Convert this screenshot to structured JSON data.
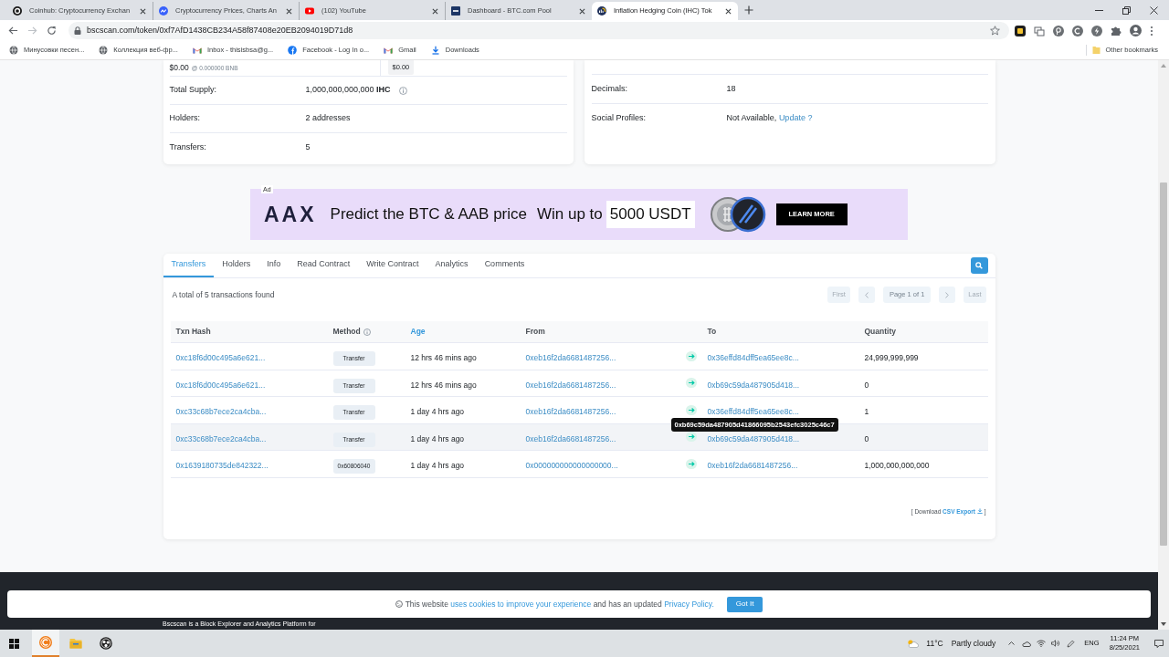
{
  "browser": {
    "tabs": [
      {
        "title": "Coinhub: Cryptocurrency Exchan",
        "kind": "ring",
        "selected": false
      },
      {
        "title": "Cryptocurrency Prices, Charts An",
        "kind": "badge",
        "selected": false
      },
      {
        "title": "(102) YouTube",
        "kind": "play",
        "selected": false
      },
      {
        "title": "Dashboard - BTC.com Pool",
        "kind": "square",
        "selected": false
      },
      {
        "title": "Inflation Hedging Coin (IHC) Tok",
        "kind": "logo",
        "selected": true
      }
    ],
    "address": "bscscan.com/token/0xf7AfD1438CB234A58f87408e20EB2094019D71d8",
    "bookmarks": [
      {
        "label": "Минусовки песен...",
        "kind": "globe"
      },
      {
        "label": "Коллекция веб-фр...",
        "kind": "globe"
      },
      {
        "label": "Inbox - thisisbsa@g...",
        "kind": "mail"
      },
      {
        "label": "Facebook - Log In o...",
        "kind": "social"
      },
      {
        "label": "Gmail",
        "kind": "mail"
      },
      {
        "label": "Downloads",
        "kind": "download"
      }
    ],
    "other_bookmarks": "Other bookmarks"
  },
  "overview": {
    "price": "$0.00",
    "price_bnb": "@ 0.000000 BNB",
    "market_cap": "$0.00",
    "rows": [
      {
        "label": "Total Supply:",
        "value": "1,000,000,000,000 **IHC**",
        "info": true
      },
      {
        "label": "Holders:",
        "value": "2 addresses",
        "info": false
      },
      {
        "label": "Transfers:",
        "value": "5",
        "info": false
      }
    ]
  },
  "profile": {
    "rows": [
      {
        "label": "Decimals:",
        "value": "18"
      },
      {
        "label": "Social Profiles:",
        "value": "Not Available,",
        "link": "Update ?"
      }
    ]
  },
  "ad": {
    "tag": "Ad",
    "logo": "AAX",
    "headline": "Predict the BTC & AAB price",
    "offer": "Win up to",
    "highlight": "5000 USDT",
    "button": "LEARN MORE"
  },
  "tabs": [
    {
      "label": "Transfers",
      "selected": true
    },
    {
      "label": "Holders",
      "selected": false
    },
    {
      "label": "Info",
      "selected": false
    },
    {
      "label": "Read Contract",
      "selected": false
    },
    {
      "label": "Write Contract",
      "selected": false
    },
    {
      "label": "Analytics",
      "selected": false
    },
    {
      "label": "Comments",
      "selected": false
    }
  ],
  "summary": "A total of 5 transactions found",
  "pagination": [
    {
      "kind": "first",
      "label": "First",
      "disabled": true
    },
    {
      "kind": "prev",
      "disabled": true
    },
    {
      "kind": "page",
      "label": "Page 1 of 1"
    },
    {
      "kind": "next",
      "disabled": true
    },
    {
      "kind": "last",
      "label": "Last",
      "disabled": true
    }
  ],
  "table": {
    "columns": [
      {
        "label": "Txn Hash",
        "kind": "text"
      },
      {
        "label": "Method",
        "kind": "info"
      },
      {
        "label": "Age",
        "kind": "link"
      },
      {
        "label": "From",
        "kind": "text"
      },
      {
        "label": "To",
        "kind": "text"
      },
      {
        "label": "Quantity",
        "kind": "text"
      }
    ],
    "rows": [
      {
        "txn_hash": "0xc18f6d00c495a6e621...",
        "method": "Transfer",
        "age": "12 hrs 46 mins ago",
        "from": "0xeb16f2da6681487256...",
        "to": "0x36effd84dff5ea65ee8c...",
        "quantity": "24,999,999,999",
        "hovered": false
      },
      {
        "txn_hash": "0xc18f6d00c495a6e621...",
        "method": "Transfer",
        "age": "12 hrs 46 mins ago",
        "from": "0xeb16f2da6681487256...",
        "to": "0xb69c59da487905d418...",
        "quantity": "0",
        "hovered": false
      },
      {
        "txn_hash": "0xc33c68b7ece2ca4cba...",
        "method": "Transfer",
        "age": "1 day 4 hrs ago",
        "from": "0xeb16f2da6681487256...",
        "to": "0x36effd84dff5ea65ee8c...",
        "quantity": "1",
        "hovered": false
      },
      {
        "txn_hash": "0xc33c68b7ece2ca4cba...",
        "method": "Transfer",
        "age": "1 day 4 hrs ago",
        "from": "0xeb16f2da6681487256...",
        "to": "0xb69c59da487905d418...",
        "quantity": "0",
        "hovered": true
      },
      {
        "txn_hash": "0x1639180735de842322...",
        "method": "0x60806040",
        "age": "1 day 4 hrs ago",
        "from": "0x000000000000000000...",
        "to": "0xeb16f2da6681487256...",
        "quantity": "1,000,000,000,000",
        "hovered": false
      }
    ],
    "tooltip": "0xb69c59da487905d41866095b2543efc3025c46c7"
  },
  "csv": {
    "before": "[ Download ",
    "link": "CSV Export",
    "after": " ]"
  },
  "footer": {
    "text": "Bscscan is a Block Explorer and Analytics Platform for"
  },
  "cookie": {
    "parts": [
      {
        "text": "This website ",
        "kind": "text"
      },
      {
        "text": "uses cookies to improve your experience",
        "kind": "link"
      },
      {
        "text": " and has an updated ",
        "kind": "text"
      },
      {
        "text": "Privacy Policy.",
        "kind": "link"
      }
    ],
    "button": "Got It"
  },
  "taskbar": {
    "apps": [
      {
        "kind": "coin",
        "selected": true
      },
      {
        "kind": "folder",
        "selected": false
      },
      {
        "kind": "disc",
        "selected": false
      }
    ],
    "temperature": "11°C",
    "condition": "Partly cloudy",
    "language": "ENG",
    "time": "11:24 PM",
    "date": "8/25/2021"
  }
}
